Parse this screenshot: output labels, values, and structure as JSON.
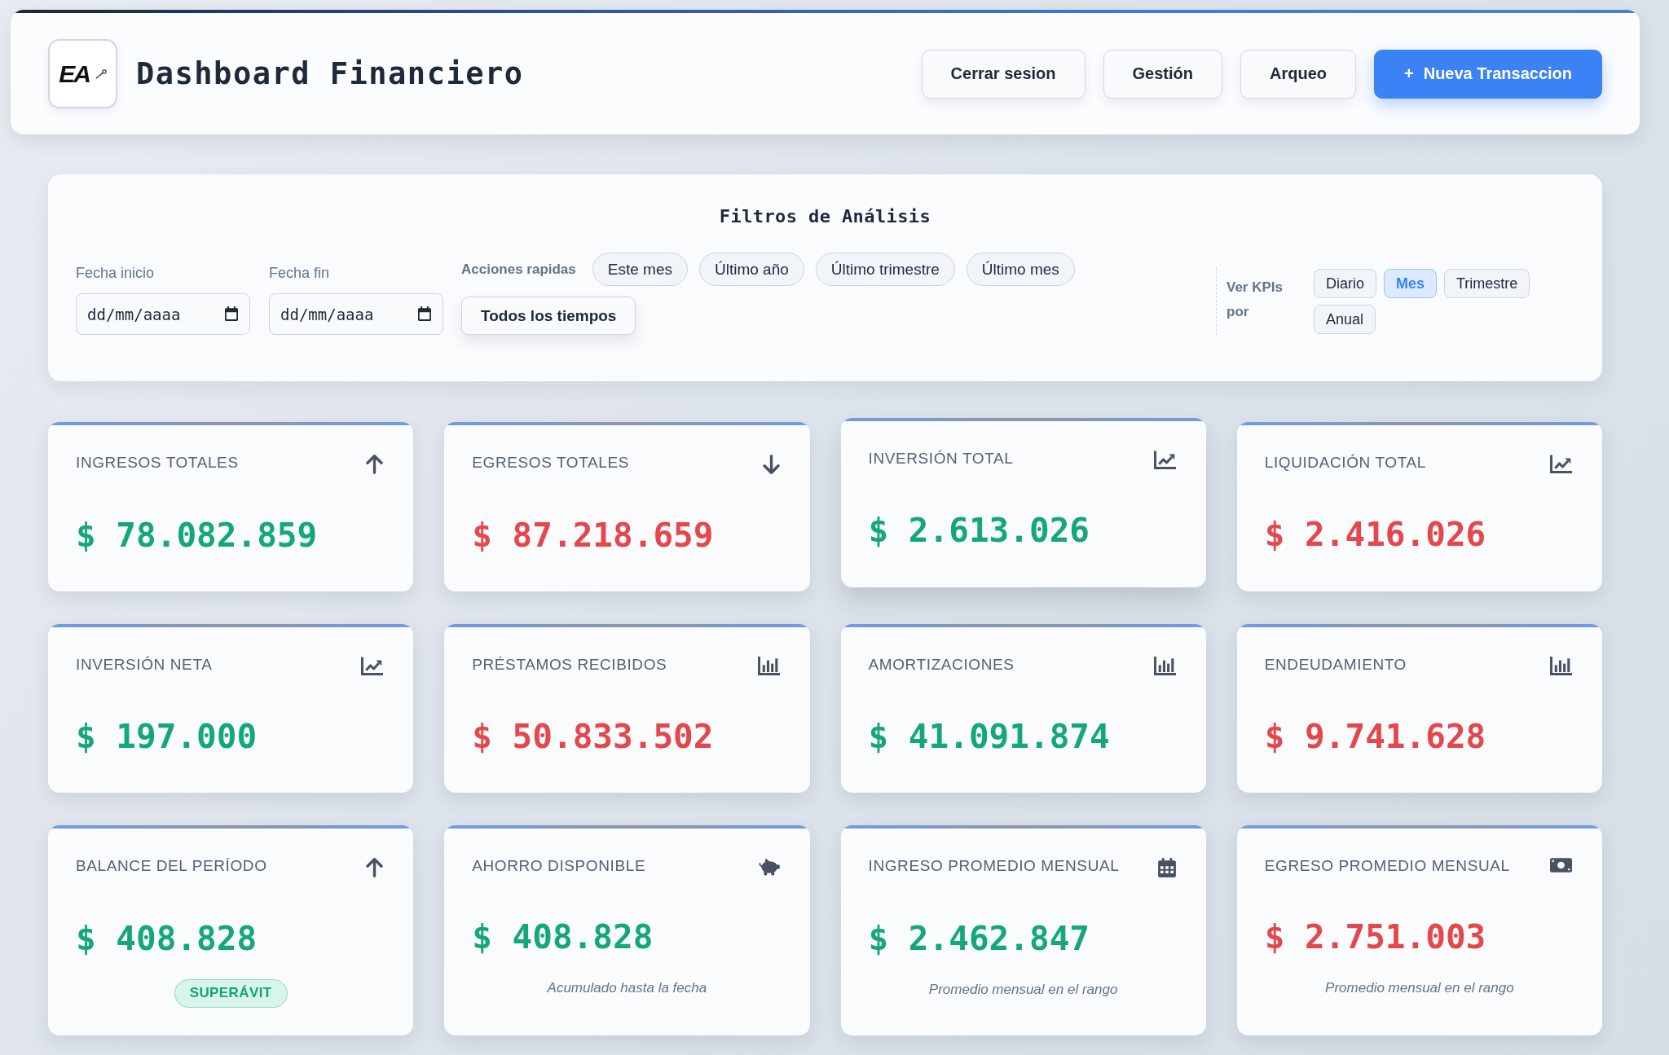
{
  "header": {
    "logo_text": "EA",
    "title": "Dashboard Financiero",
    "buttons": [
      {
        "label": "Cerrar sesion",
        "kind": "secondary"
      },
      {
        "label": "Gestión",
        "kind": "secondary"
      },
      {
        "label": "Arqueo",
        "kind": "secondary"
      },
      {
        "label": "Nueva Transaccion",
        "prefix": "+",
        "kind": "primary"
      }
    ]
  },
  "filters": {
    "title": "Filtros de Análisis",
    "date_fields": [
      {
        "label": "Fecha inicio",
        "placeholder": "dd/mm/aaaa"
      },
      {
        "label": "Fecha fin",
        "placeholder": "dd/mm/aaaa"
      }
    ],
    "quick_actions": {
      "label": "Acciones rapidas",
      "chips": [
        "Este mes",
        "Último año",
        "Último trimestre",
        "Último mes"
      ],
      "all_time_button": "Todos los tiempos"
    },
    "kpi_period": {
      "label": "Ver KPIs por",
      "options": [
        {
          "label": "Diario",
          "selected": false
        },
        {
          "label": "Mes",
          "selected": true
        },
        {
          "label": "Trimestre",
          "selected": false
        },
        {
          "label": "Anual",
          "selected": false
        }
      ]
    }
  },
  "kpis": [
    {
      "label": "INGRESOS TOTALES",
      "value": "$ 78.082.859",
      "color": "#14a878",
      "kind": "up",
      "hovered": false
    },
    {
      "label": "EGRESOS TOTALES",
      "value": "$ 87.218.659",
      "color": "#e4474c",
      "kind": "down",
      "hovered": false
    },
    {
      "label": "INVERSIÓN TOTAL",
      "value": "$ 2.613.026",
      "color": "#14a878",
      "kind": "trend",
      "hovered": true
    },
    {
      "label": "LIQUIDACIÓN TOTAL",
      "value": "$ 2.416.026",
      "color": "#e4474c",
      "kind": "trend",
      "hovered": false
    },
    {
      "label": "INVERSIÓN NETA",
      "value": "$ 197.000",
      "color": "#14a878",
      "kind": "trend",
      "hovered": false
    },
    {
      "label": "PRÉSTAMOS RECIBIDOS",
      "value": "$ 50.833.502",
      "color": "#e4474c",
      "kind": "bars",
      "hovered": false
    },
    {
      "label": "AMORTIZACIONES",
      "value": "$ 41.091.874",
      "color": "#14a878",
      "kind": "bars",
      "hovered": false
    },
    {
      "label": "ENDEUDAMIENTO",
      "value": "$ 9.741.628",
      "color": "#e4474c",
      "kind": "bars",
      "hovered": false
    },
    {
      "label": "BALANCE DEL PERÍODO",
      "value": "$ 408.828",
      "color": "#14a878",
      "kind": "up",
      "hovered": false,
      "badge": "SUPERÁVIT"
    },
    {
      "label": "AHORRO DISPONIBLE",
      "value": "$ 408.828",
      "color": "#14a878",
      "kind": "savings",
      "hovered": false,
      "note": "Acumulado hasta la fecha"
    },
    {
      "label": "INGRESO PROMEDIO MENSUAL",
      "value": "$ 2.462.847",
      "color": "#14a878",
      "kind": "monthly",
      "hovered": false,
      "note": "Promedio mensual en el rango"
    },
    {
      "label": "EGRESO PROMEDIO MENSUAL",
      "value": "$ 2.751.003",
      "color": "#e4474c",
      "kind": "cash",
      "hovered": false,
      "note": "Promedio mensual en el rango"
    }
  ]
}
